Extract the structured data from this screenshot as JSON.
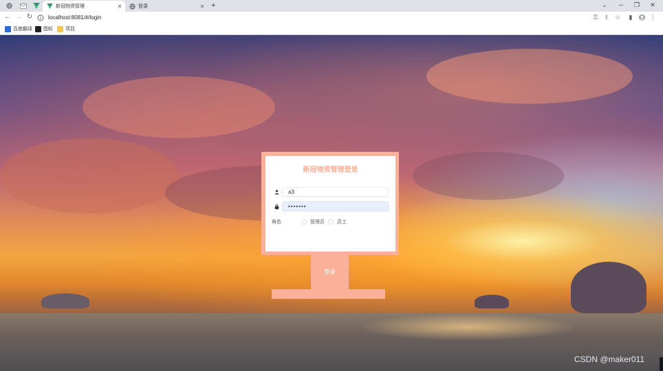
{
  "browser": {
    "tabs": [
      {
        "title": "新冠物资管理",
        "active": true
      },
      {
        "title": "登录",
        "active": false
      }
    ],
    "address": "localhost:8081/#/login",
    "bookmarks": [
      {
        "label": "百度翻译"
      },
      {
        "label": "图标"
      },
      {
        "label": "项目"
      }
    ]
  },
  "login": {
    "title": "新冠物资管理登录",
    "username": "a3",
    "password_mask": "•••••••",
    "role_label": "角色",
    "role_options": [
      {
        "label": "管理员",
        "selected": false
      },
      {
        "label": "员工",
        "selected": false
      }
    ],
    "submit_label": "登录"
  },
  "watermark": "CSDN @maker011",
  "colors": {
    "accent": "#fbb199",
    "card": "#ffffff",
    "password_fill": "#e8f0fe"
  }
}
